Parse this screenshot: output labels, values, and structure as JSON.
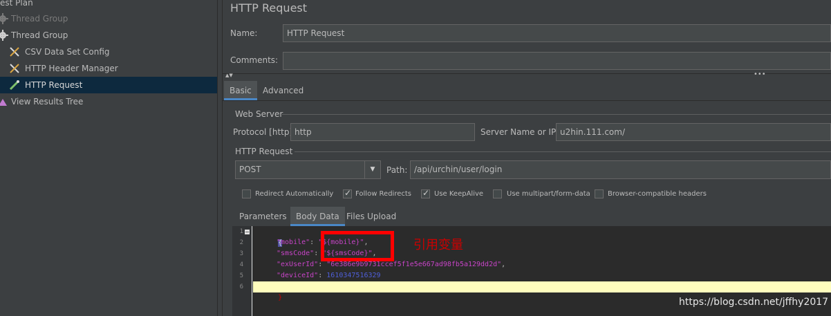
{
  "tree": {
    "items": [
      {
        "label": "est Plan"
      },
      {
        "label": "Thread Group"
      },
      {
        "label": "Thread Group"
      },
      {
        "label": "CSV Data Set Config"
      },
      {
        "label": "HTTP Header Manager"
      },
      {
        "label": "HTTP Request"
      },
      {
        "label": "View Results Tree"
      }
    ]
  },
  "panel": {
    "title": "HTTP Request",
    "name_label": "Name:",
    "name_value": "HTTP Request",
    "comments_label": "Comments:",
    "comments_value": "",
    "tabs": [
      "Basic",
      "Advanced"
    ],
    "web_server": {
      "group_label": "Web Server",
      "protocol_label": "Protocol [http]:",
      "protocol_value": "http",
      "server_label": "Server Name or IP:",
      "server_value": "u2hin.111.com/"
    },
    "http_request": {
      "group_label": "HTTP Request",
      "method": "POST",
      "path_label": "Path:",
      "path_value": "/api/urchin/user/login"
    },
    "options": [
      {
        "label": "Redirect Automatically",
        "checked": false
      },
      {
        "label": "Follow Redirects",
        "checked": true
      },
      {
        "label": "Use KeepAlive",
        "checked": true
      },
      {
        "label": "Use multipart/form-data",
        "checked": false
      },
      {
        "label": "Browser-compatible headers",
        "checked": false
      }
    ],
    "subtabs": [
      "Parameters",
      "Body Data",
      "Files Upload"
    ]
  },
  "editor": {
    "line_numbers": [
      "1",
      "2",
      "3",
      "4",
      "5",
      "6"
    ],
    "lines": [
      {
        "open": "{"
      },
      {
        "key": "\"mobile\"",
        "sep": ":",
        "value": "\"${mobile}\"",
        "end": ","
      },
      {
        "key": "\"smsCode\"",
        "sep": ":",
        "value": "\"${smsCode}\"",
        "end": ","
      },
      {
        "key": "\"exUserId\"",
        "sep": ":",
        "value": "\"6e386e9b9731ccef5f1e5e667ad98fb5a129dd2d\"",
        "end": ","
      },
      {
        "key": "\"deviceId\"",
        "sep": ":",
        "value": "1610347516329",
        "end": ""
      },
      {
        "close": "}"
      }
    ]
  },
  "annotation": "引用变量",
  "watermark": "https://blog.csdn.net/jffhy2017",
  "colors": {
    "accent": "#4a88c7",
    "selection": "#0d293e",
    "highlight_box": "#ff0000",
    "json_key": "#c844c8",
    "json_number": "#4f5fd9"
  }
}
